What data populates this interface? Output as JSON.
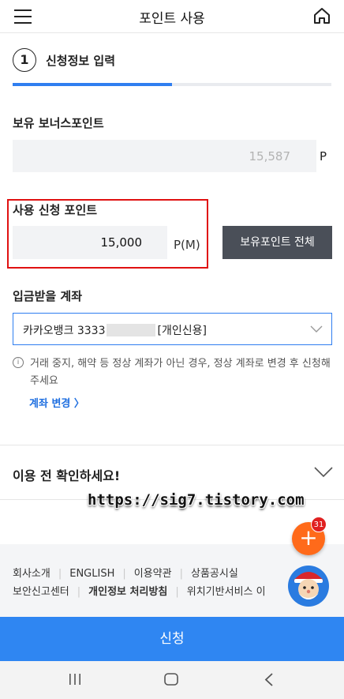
{
  "header": {
    "title": "포인트 사용",
    "menu_icon": "hamburger-icon",
    "home_icon": "home-icon"
  },
  "step": {
    "number": "1",
    "label": "신청정보 입력",
    "progress_fraction": 0.5
  },
  "bonus_points": {
    "label": "보유 보너스포인트",
    "value": "15,587",
    "unit": "P"
  },
  "apply_points": {
    "label": "사용 신청 포인트",
    "value": "15,000",
    "unit": "P(M)",
    "all_button": "보유포인트 전체"
  },
  "account": {
    "label": "입금받을 계좌",
    "bank_prefix": "카카오뱅크 3333",
    "suffix": "[개인신용]",
    "notice": "거래 중지, 해약 등 정상 계좌가 아닌 경우, 정상 계좌로 변경 후 신청해 주세요",
    "change_link": "계좌 변경 〉"
  },
  "confirm": {
    "label": "이용 전 확인하세요!"
  },
  "watermark": "https://sig7.tistory.com",
  "footer": {
    "row1": [
      "회사소개",
      "ENGLISH",
      "이용약관",
      "상품공시실"
    ],
    "row2": [
      "보안신고센터",
      "개인정보 처리방침",
      "위치기반서비스 이"
    ]
  },
  "fab": {
    "symbol": "+",
    "badge": "31"
  },
  "submit_label": "신청",
  "colors": {
    "accent": "#2f7ef0",
    "submit": "#2f86f2",
    "highlight": "#e01111",
    "fab": "#ff6a1a",
    "dark_button": "#4a4f58"
  }
}
